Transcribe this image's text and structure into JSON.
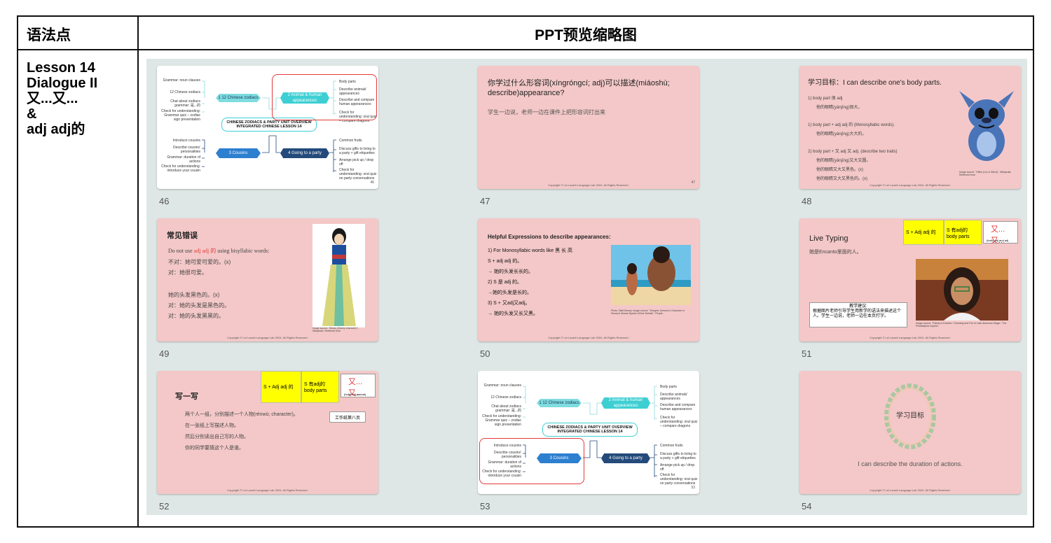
{
  "table": {
    "col1_header": "语法点",
    "col2_header": "PPT预览缩略图"
  },
  "lesson_lines": [
    "Lesson 14",
    "Dialogue II",
    "又...又...",
    "&",
    "adj adj的"
  ],
  "slide_numbers": [
    "46",
    "47",
    "48",
    "49",
    "50",
    "51",
    "52",
    "53",
    "54"
  ],
  "copyright": "Copyright © Lei Laoshi Language Lab 2024. All Rights Reserved.",
  "mindmap": {
    "title1": "CHINESE ZODIACS & PARTY UNIT OVERVIEW",
    "title2": "INTEGRATED CHINESE LESSON 14",
    "n1": "1 12 Chinese zodiacs",
    "n2": "2 Animal & human appearances",
    "n3": "3 Cousins",
    "n4": "4 Going to a party",
    "l1": [
      "Grammar: noun clauses",
      "12 Chinese zodiacs",
      "Chat about zodiacs grammar: 是...的",
      "Check for understanding: Grammar quiz – zodiac sign presentation"
    ],
    "l2": [
      "Body parts",
      "Describe animals' appearances",
      "Describe and compare human appearances",
      "Check for understanding: oral quiz – compare dragons"
    ],
    "l3": [
      "Introduce cousins",
      "Describe cousins' personalities",
      "Grammar: duration of actions",
      "Check for understanding: introduce your cousin"
    ],
    "l4": [
      "Common fruits",
      "Discuss gifts to bring to a party + gift etiquettes",
      "Arrange pick up / drop off",
      "Check for understanding: oral quiz on party conversations"
    ]
  },
  "s47": {
    "title": "你学过什么形容词(xíngróngcí; adj)可以描述(miáoshù; describe)appearance?",
    "body": "学生一边说，老师一边在课件上把形容词打出来"
  },
  "s48": {
    "title": "学习目标：I can describe one's body parts.",
    "l1": "1) body part 很 adj",
    "r1": "他的眼睛(yǎnjīng)很大。",
    "l2": "1) body part + adj adj 的 (Monosyllabic words).",
    "r2": "他的眼睛(yǎnjīng)大大的。",
    "l3": "2) body part + 又 adj 又 adj. (describe two traits)",
    "r3": [
      "他的眼睛(yǎnjīng)又大又圆。",
      "他的眼睛又大又黑色。(x)",
      "他的眼睛又大又黑色的。(x)"
    ],
    "src": "Image source: \"Stitch (Lilo & Stitch)\". Wikipedia. Retrieved from"
  },
  "s49": {
    "title": "常见错误",
    "l1a": "Do not use ",
    "l1b": "adj adj 的",
    "l1c": " using bisyllabic words:",
    "lines": [
      "不对：她可爱可爱的。(x)",
      "对：她很可爱。",
      "",
      "她的头发黑色的。(x)",
      "对：她的头发是黑色的。",
      "对：她的头发黑黑的。"
    ],
    "src": "Image source: \"Mulan (Disney character)\". Wikipedia. Retrieved from"
  },
  "s50": {
    "title": "Helpful Expressions to describe appearances:",
    "lines": [
      "1) For Monosyllabic words like 黑 长 高",
      "S + adj adj 的。",
      "→ 她的头发长长的。",
      "2)  S 是 adj 的。",
      "→她的头发是长的。",
      "3)  S + 又adj又adj。",
      "→ 她的头发又长又黑。"
    ],
    "src": "Photo: Walt Disney. Image source: \"Dwayne Johnson's Character in Disney's Moana Sparks Online Debate\". People."
  },
  "s51": {
    "title": "Live Typing",
    "y1": "S + Adj adj 的",
    "y2": "S 有adj的 body parts",
    "chip": "又...又...",
    "chip2": "(both) adj and adj",
    "body": "她是Encanto里面的人。",
    "tip_title": "教学建议:",
    "tip": "根据图片老师引导学生用新学的语法来描述这个人。学生一边说，老师一边在本页打字。",
    "src": "Image source: \"Disney's Encanto: Charming and Full of Latin American Magic\". The Philadelphia Inquirer."
  },
  "s52": {
    "title": "写一写",
    "y1": "S + Adj adj 的",
    "y2": "S 有adj的 body parts",
    "chip": "又...又...",
    "chip2": "(both) adj and adj",
    "lines": [
      "两个人一组，分别描述一个人物(rénwù; character)。",
      "在一张纸上写描述人物。",
      "然后分别读出自己写的人物。",
      "你的同学要猜这个人是谁。"
    ],
    "sheet": "工作纸第八页"
  },
  "s54": {
    "title": "学习目标",
    "body": "I can describe the duration of actions."
  },
  "colors": {
    "slide_pink": "#f4c8c8",
    "gallery_bg": "#dfe7e6",
    "teal": "#3ecfd3",
    "navy": "#234a7a",
    "blue": "#2d7fd0",
    "red": "#e23b3b",
    "yellow": "#ffff00"
  }
}
